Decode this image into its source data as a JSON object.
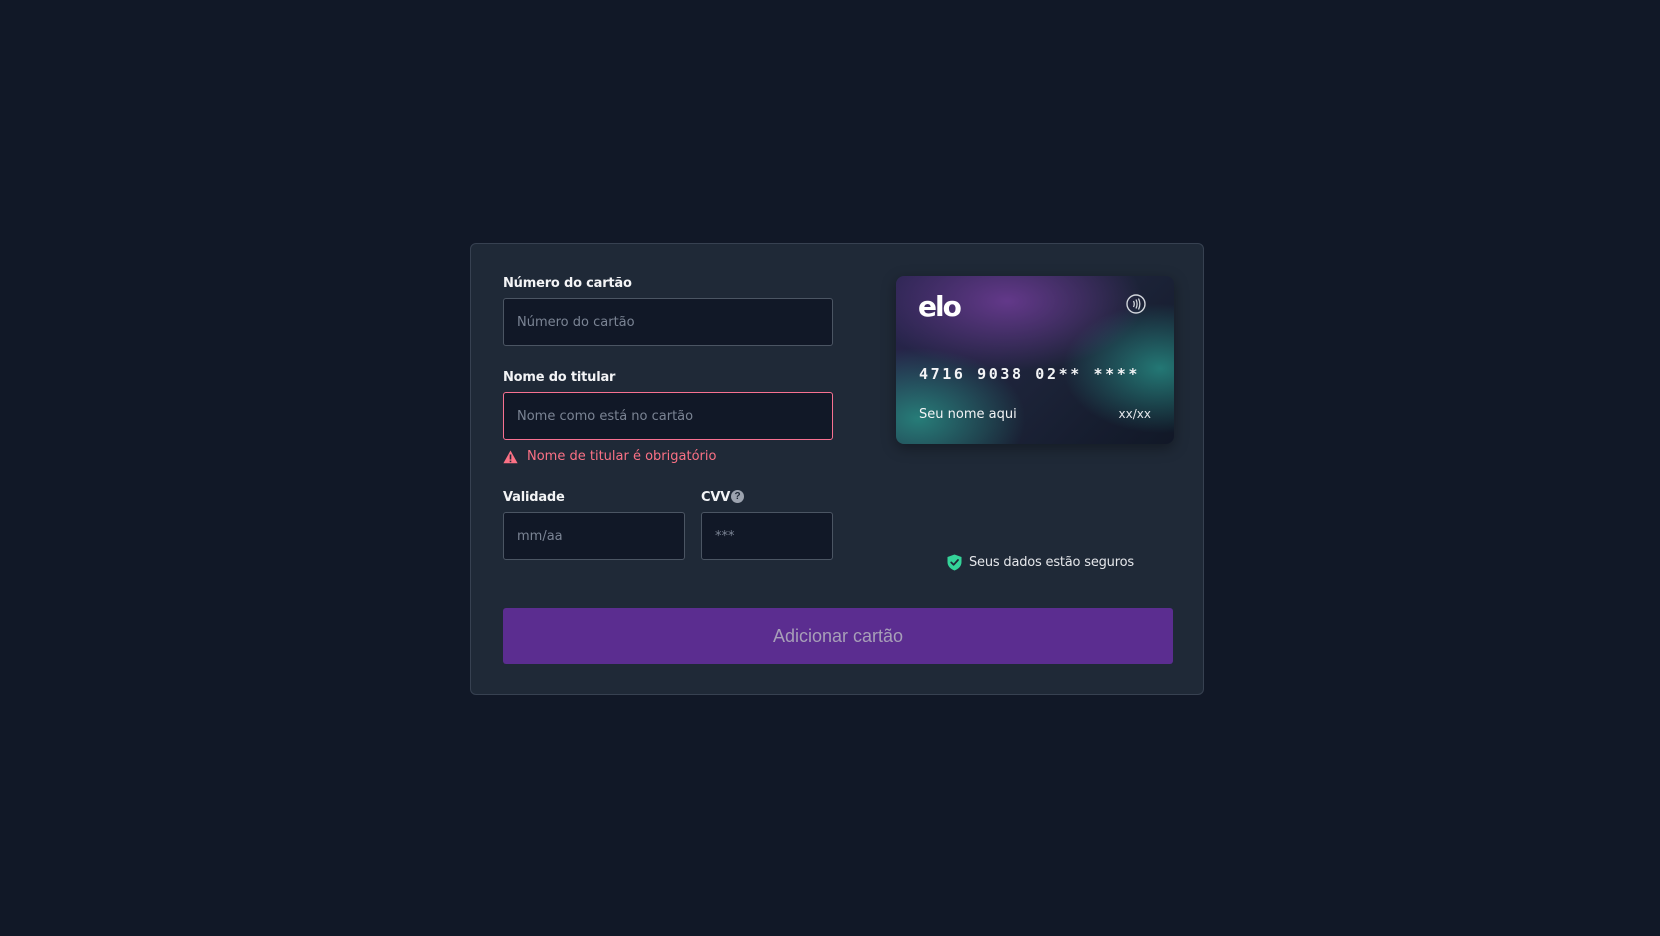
{
  "form": {
    "card_number": {
      "label": "Número do cartão",
      "placeholder": "Número do cartão",
      "value": ""
    },
    "holder_name": {
      "label": "Nome do titular",
      "placeholder": "Nome como está no cartão",
      "value": "",
      "error": "Nome de titular é obrigatório"
    },
    "expiry": {
      "label": "Validade",
      "placeholder": "mm/aa",
      "value": ""
    },
    "cvv": {
      "label": "CVV",
      "placeholder": "***",
      "value": ""
    },
    "submit_label": "Adicionar cartão"
  },
  "card_preview": {
    "brand": "elo",
    "number": "4716 9038 02** ****",
    "holder": "Seu nome aqui",
    "expiry": "xx/xx"
  },
  "secure_note": "Seus dados estão seguros",
  "colors": {
    "background": "#111827",
    "panel": "#1f2937",
    "accent": "#5b2d90",
    "error": "#fb7185",
    "secure": "#34d399"
  }
}
